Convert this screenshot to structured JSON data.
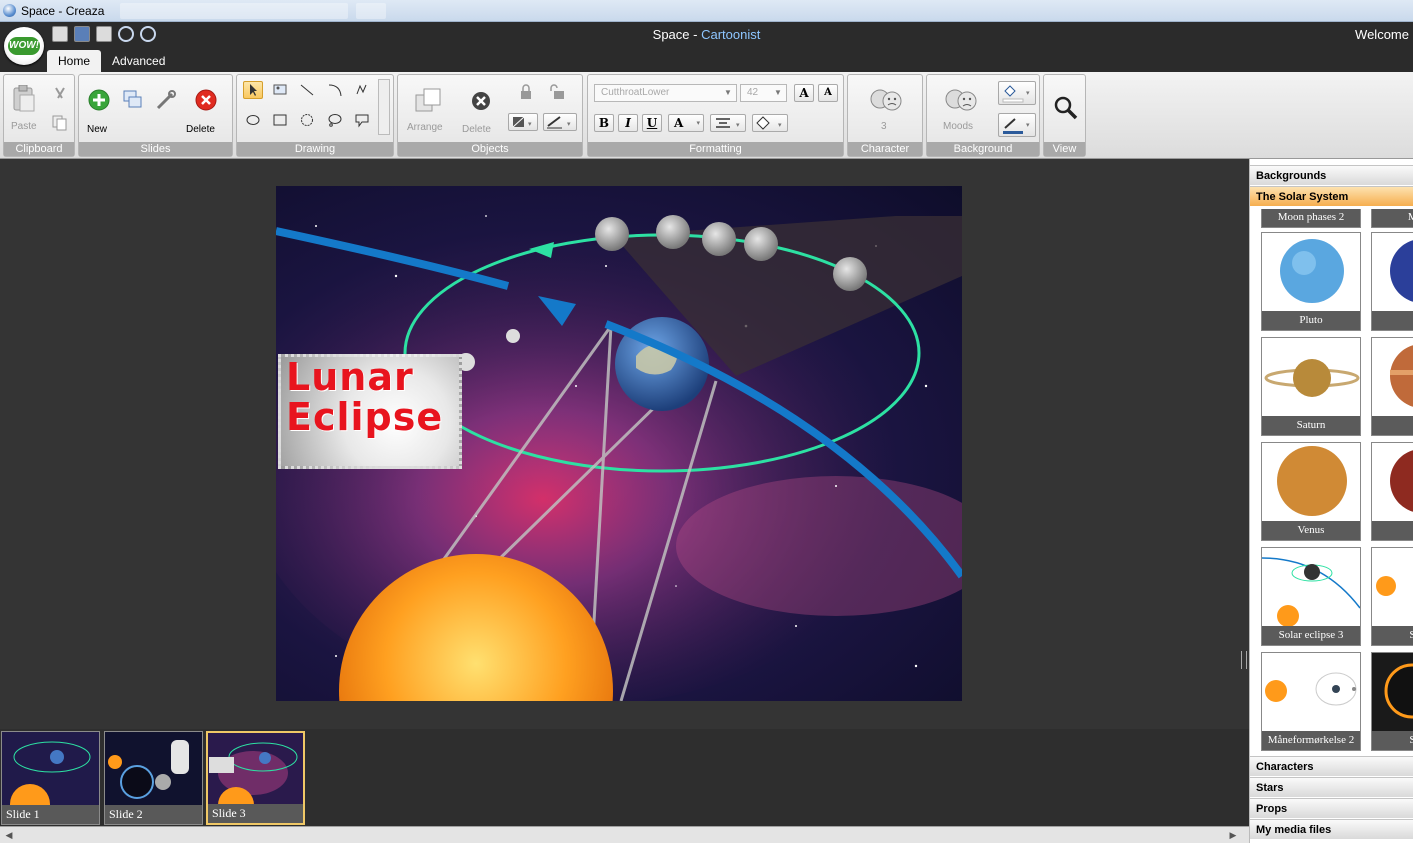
{
  "window": {
    "title": "Space - Creaza"
  },
  "header": {
    "logo_text": "WOW!",
    "title_main": "Space - ",
    "title_accent": "Cartoonist",
    "welcome": "Welcome"
  },
  "tabs": [
    {
      "label": "Home",
      "active": true
    },
    {
      "label": "Advanced",
      "active": false
    }
  ],
  "ribbon": {
    "clipboard": {
      "label": "Clipboard",
      "paste": "Paste"
    },
    "slides": {
      "label": "Slides",
      "new": "New",
      "delete": "Delete"
    },
    "drawing": {
      "label": "Drawing"
    },
    "objects": {
      "label": "Objects",
      "arrange": "Arrange",
      "delete": "Delete"
    },
    "formatting": {
      "label": "Formatting",
      "font": "CutthroatLower",
      "size": "42",
      "bold": "B",
      "italic": "I",
      "underline": "U",
      "font_color": "A",
      "grow": "A",
      "shrink": "A"
    },
    "character": {
      "label": "Character",
      "count": "3"
    },
    "background": {
      "label": "Background",
      "moods": "Moods"
    },
    "view": {
      "label": "View"
    }
  },
  "stage": {
    "title_line1": "Lunar",
    "title_line2": "Eclipse"
  },
  "slides": [
    {
      "label": "Slide 1",
      "selected": false
    },
    {
      "label": "Slide 2",
      "selected": false
    },
    {
      "label": "Slide 3",
      "selected": true
    }
  ],
  "library": {
    "sections": {
      "backgrounds": "Backgrounds",
      "solar_system": "The Solar System",
      "characters": "Characters",
      "stars": "Stars",
      "props": "Props",
      "my_media": "My media files"
    },
    "items": [
      {
        "label": "Moon phases 2"
      },
      {
        "label": "Moon"
      },
      {
        "label": "Pluto"
      },
      {
        "label": "Ne"
      },
      {
        "label": "Saturn"
      },
      {
        "label": "Ju"
      },
      {
        "label": "Venus"
      },
      {
        "label": "M"
      },
      {
        "label": "Solar eclipse 3"
      },
      {
        "label": "Solar"
      },
      {
        "label": "Måneformørkelse 2"
      },
      {
        "label": "Solar"
      }
    ]
  },
  "colors": {
    "accent": "#8ec6ff",
    "title_red": "#e8141e",
    "orbit": "#2de1a3",
    "arrow_blue": "#1479c9",
    "selected_gold": "#f0c866"
  }
}
